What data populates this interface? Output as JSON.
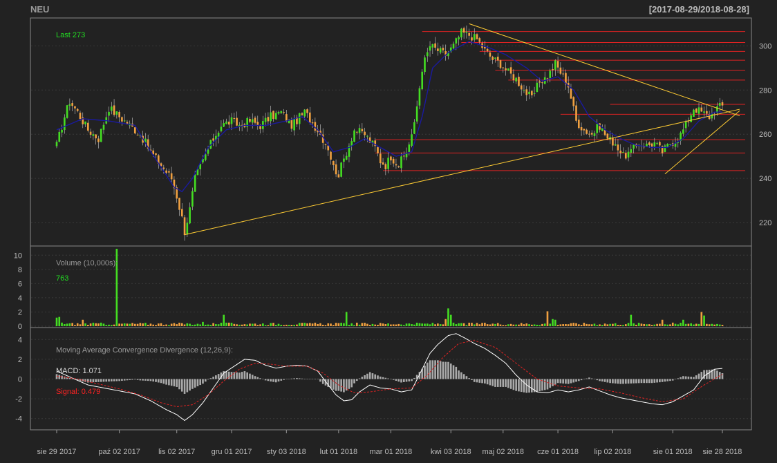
{
  "header": {
    "symbol": "NEU",
    "date_range": "[2017-08-29/2018-08-28]"
  },
  "colors": {
    "background": "#222222",
    "panel_border": "#888888",
    "grid": "#3a3a3a",
    "candle_up": "#44dd22",
    "candle_down": "#f0a040",
    "ma_line": "#1a1aa0",
    "support_resistance": "#dd2222",
    "trendline": "#ffcc33",
    "macd_line": "#ffffff",
    "signal_line": "#dd2222",
    "histogram": "#aaaaaa",
    "label_green": "#22dd22",
    "label_red": "#ff2222",
    "label_grey": "#999999"
  },
  "x_axis": {
    "labels": [
      {
        "label": "sie 29 2017",
        "index": 0
      },
      {
        "label": "paź 02 2017",
        "index": 24
      },
      {
        "label": "lis 02 2017",
        "index": 46
      },
      {
        "label": "gru 01 2017",
        "index": 67
      },
      {
        "label": "sty 03 2018",
        "index": 88
      },
      {
        "label": "lut 01 2018",
        "index": 108
      },
      {
        "label": "mar 01 2018",
        "index": 128
      },
      {
        "label": "kwi 03 2018",
        "index": 151
      },
      {
        "label": "maj 02 2018",
        "index": 171
      },
      {
        "label": "cze 01 2018",
        "index": 192
      },
      {
        "label": "lip 02 2018",
        "index": 213
      },
      {
        "label": "sie 01 2018",
        "index": 236
      },
      {
        "label": "sie 28 2018",
        "index": 255
      }
    ]
  },
  "price_panel": {
    "last_label": "Last 273"
  },
  "volume_panel": {
    "title": "Volume (10,000s):",
    "last_value": "763"
  },
  "macd_panel": {
    "title": "Moving Average Convergence Divergence (12,26,9):",
    "macd_label": "MACD: 1.071",
    "signal_label": "Signal: 0.479"
  },
  "chart_data": [
    {
      "type": "candlestick",
      "title": "NEU",
      "ylim": [
        210,
        312
      ],
      "yticks": [
        220,
        240,
        260,
        280,
        300
      ],
      "n_bars": 256,
      "anchors": [
        [
          0,
          255
        ],
        [
          3,
          268
        ],
        [
          5,
          275
        ],
        [
          8,
          270
        ],
        [
          12,
          262
        ],
        [
          16,
          258
        ],
        [
          20,
          272
        ],
        [
          24,
          268
        ],
        [
          28,
          264
        ],
        [
          32,
          260
        ],
        [
          36,
          252
        ],
        [
          40,
          246
        ],
        [
          44,
          240
        ],
        [
          46,
          232
        ],
        [
          48,
          222
        ],
        [
          49,
          216
        ],
        [
          51,
          226
        ],
        [
          53,
          240
        ],
        [
          56,
          248
        ],
        [
          60,
          258
        ],
        [
          63,
          264
        ],
        [
          67,
          266
        ],
        [
          70,
          264
        ],
        [
          74,
          266
        ],
        [
          78,
          264
        ],
        [
          82,
          268
        ],
        [
          86,
          270
        ],
        [
          90,
          264
        ],
        [
          95,
          270
        ],
        [
          100,
          262
        ],
        [
          104,
          254
        ],
        [
          106,
          245
        ],
        [
          108,
          242
        ],
        [
          111,
          252
        ],
        [
          114,
          262
        ],
        [
          118,
          260
        ],
        [
          122,
          254
        ],
        [
          124,
          248
        ],
        [
          126,
          246
        ],
        [
          128,
          250
        ],
        [
          131,
          246
        ],
        [
          134,
          252
        ],
        [
          137,
          264
        ],
        [
          140,
          290
        ],
        [
          143,
          300
        ],
        [
          146,
          298
        ],
        [
          149,
          296
        ],
        [
          152,
          300
        ],
        [
          155,
          306
        ],
        [
          158,
          305
        ],
        [
          161,
          303
        ],
        [
          164,
          298
        ],
        [
          167,
          294
        ],
        [
          170,
          292
        ],
        [
          173,
          288
        ],
        [
          176,
          285
        ],
        [
          179,
          280
        ],
        [
          182,
          276
        ],
        [
          185,
          284
        ],
        [
          188,
          286
        ],
        [
          191,
          292
        ],
        [
          194,
          286
        ],
        [
          196,
          282
        ],
        [
          199,
          266
        ],
        [
          202,
          262
        ],
        [
          205,
          260
        ],
        [
          208,
          264
        ],
        [
          211,
          258
        ],
        [
          214,
          256
        ],
        [
          217,
          250
        ],
        [
          220,
          252
        ],
        [
          223,
          256
        ],
        [
          226,
          255
        ],
        [
          229,
          256
        ],
        [
          232,
          252
        ],
        [
          235,
          256
        ],
        [
          238,
          258
        ],
        [
          241,
          264
        ],
        [
          244,
          272
        ],
        [
          247,
          270
        ],
        [
          250,
          268
        ],
        [
          253,
          272
        ],
        [
          255,
          273
        ]
      ],
      "moving_average_anchors": [
        [
          0,
          262
        ],
        [
          10,
          267
        ],
        [
          20,
          266
        ],
        [
          30,
          264
        ],
        [
          35,
          254
        ],
        [
          40,
          245
        ],
        [
          45,
          236
        ],
        [
          48,
          234
        ],
        [
          52,
          240
        ],
        [
          58,
          254
        ],
        [
          65,
          262
        ],
        [
          72,
          264
        ],
        [
          80,
          264
        ],
        [
          88,
          266
        ],
        [
          94,
          268
        ],
        [
          100,
          262
        ],
        [
          106,
          252
        ],
        [
          112,
          254
        ],
        [
          118,
          258
        ],
        [
          124,
          254
        ],
        [
          130,
          250
        ],
        [
          136,
          252
        ],
        [
          140,
          268
        ],
        [
          144,
          290
        ],
        [
          150,
          297
        ],
        [
          158,
          302
        ],
        [
          166,
          299
        ],
        [
          172,
          296
        ],
        [
          180,
          290
        ],
        [
          186,
          284
        ],
        [
          192,
          286
        ],
        [
          198,
          280
        ],
        [
          204,
          268
        ],
        [
          210,
          262
        ],
        [
          216,
          258
        ],
        [
          222,
          255
        ],
        [
          228,
          254
        ],
        [
          234,
          254
        ],
        [
          240,
          258
        ],
        [
          246,
          266
        ],
        [
          252,
          270
        ],
        [
          255,
          270
        ]
      ],
      "support_resistance_levels": [
        {
          "price": 306.5,
          "from": 140
        },
        {
          "price": 301.5,
          "from": 155
        },
        {
          "price": 297.5,
          "from": 162
        },
        {
          "price": 293.5,
          "from": 168
        },
        {
          "price": 289,
          "from": 168
        },
        {
          "price": 284.5,
          "from": 173
        },
        {
          "price": 273.5,
          "from": 212
        },
        {
          "price": 269,
          "from": 193
        },
        {
          "price": 257.5,
          "from": 122
        },
        {
          "price": 251.5,
          "from": 122
        },
        {
          "price": 243.5,
          "from": 125
        }
      ],
      "trendlines": [
        {
          "from": [
            49,
            214.5
          ],
          "to": [
            253,
            269
          ]
        },
        {
          "from": [
            158,
            310
          ],
          "to": [
            255,
            271
          ]
        },
        {
          "from": [
            233,
            242
          ],
          "to": [
            255,
            264
          ]
        }
      ]
    },
    {
      "type": "bar",
      "title": "Volume (10,000s):",
      "ylim": [
        0,
        11
      ],
      "yticks": [
        0,
        2,
        4,
        6,
        8,
        10
      ],
      "spikes": [
        {
          "index": 0,
          "value": 1.2
        },
        {
          "index": 1,
          "value": 1.3
        },
        {
          "index": 2,
          "value": 0.5
        },
        {
          "index": 10,
          "value": 0.9
        },
        {
          "index": 23,
          "value": 10.9
        },
        {
          "index": 56,
          "value": 0.6
        },
        {
          "index": 64,
          "value": 1.6
        },
        {
          "index": 111,
          "value": 2.0
        },
        {
          "index": 149,
          "value": 1.0
        },
        {
          "index": 150,
          "value": 2.5
        },
        {
          "index": 151,
          "value": 1.6
        },
        {
          "index": 188,
          "value": 2.1
        },
        {
          "index": 190,
          "value": 1.0
        },
        {
          "index": 191,
          "value": 0.9
        },
        {
          "index": 220,
          "value": 1.6
        },
        {
          "index": 232,
          "value": 0.9
        },
        {
          "index": 236,
          "value": 0.5
        },
        {
          "index": 240,
          "value": 0.9
        },
        {
          "index": 247,
          "value": 2.0
        },
        {
          "index": 248,
          "value": 1.5
        }
      ]
    },
    {
      "type": "line",
      "title": "Moving Average Convergence Divergence (12,26,9):",
      "ylim": [
        -5,
        5
      ],
      "yticks": [
        -4,
        -2,
        0,
        2,
        4
      ],
      "macd_anchors": [
        [
          0,
          0.8
        ],
        [
          6,
          0.1
        ],
        [
          12,
          -0.6
        ],
        [
          18,
          -0.9
        ],
        [
          24,
          -1.2
        ],
        [
          30,
          -1.5
        ],
        [
          36,
          -2.2
        ],
        [
          42,
          -3.1
        ],
        [
          46,
          -3.6
        ],
        [
          49,
          -4.2
        ],
        [
          52,
          -3.6
        ],
        [
          56,
          -2.4
        ],
        [
          60,
          -0.9
        ],
        [
          64,
          0.6
        ],
        [
          68,
          1.3
        ],
        [
          72,
          2.0
        ],
        [
          76,
          1.9
        ],
        [
          80,
          1.4
        ],
        [
          84,
          1.1
        ],
        [
          88,
          1.3
        ],
        [
          92,
          1.4
        ],
        [
          96,
          1.3
        ],
        [
          100,
          0.8
        ],
        [
          104,
          -0.6
        ],
        [
          107,
          -1.6
        ],
        [
          110,
          -2.2
        ],
        [
          113,
          -2.1
        ],
        [
          116,
          -1.3
        ],
        [
          120,
          -0.6
        ],
        [
          124,
          -0.9
        ],
        [
          128,
          -1.0
        ],
        [
          132,
          -1.3
        ],
        [
          136,
          -1.1
        ],
        [
          140,
          1.0
        ],
        [
          143,
          2.6
        ],
        [
          146,
          3.5
        ],
        [
          150,
          4.4
        ],
        [
          153,
          4.6
        ],
        [
          156,
          4.2
        ],
        [
          160,
          3.6
        ],
        [
          164,
          3.1
        ],
        [
          168,
          2.4
        ],
        [
          172,
          1.6
        ],
        [
          176,
          0.4
        ],
        [
          180,
          -0.6
        ],
        [
          184,
          -1.3
        ],
        [
          188,
          -1.4
        ],
        [
          192,
          -1.1
        ],
        [
          196,
          -1.3
        ],
        [
          200,
          -1.1
        ],
        [
          204,
          -0.8
        ],
        [
          208,
          -1.2
        ],
        [
          212,
          -1.6
        ],
        [
          216,
          -1.9
        ],
        [
          220,
          -2.1
        ],
        [
          224,
          -2.3
        ],
        [
          228,
          -2.5
        ],
        [
          232,
          -2.6
        ],
        [
          236,
          -2.3
        ],
        [
          240,
          -1.7
        ],
        [
          244,
          -1.1
        ],
        [
          248,
          0.3
        ],
        [
          252,
          1.0
        ],
        [
          255,
          1.071
        ]
      ],
      "signal_anchors": [
        [
          0,
          0.3
        ],
        [
          8,
          0.0
        ],
        [
          16,
          -0.5
        ],
        [
          24,
          -1.0
        ],
        [
          32,
          -1.6
        ],
        [
          40,
          -2.4
        ],
        [
          46,
          -2.8
        ],
        [
          52,
          -2.6
        ],
        [
          58,
          -1.6
        ],
        [
          64,
          -0.2
        ],
        [
          70,
          1.0
        ],
        [
          76,
          1.6
        ],
        [
          82,
          1.5
        ],
        [
          88,
          1.3
        ],
        [
          96,
          1.3
        ],
        [
          102,
          0.6
        ],
        [
          108,
          -0.6
        ],
        [
          114,
          -1.4
        ],
        [
          120,
          -1.3
        ],
        [
          128,
          -1.0
        ],
        [
          136,
          -0.9
        ],
        [
          142,
          0.4
        ],
        [
          148,
          2.2
        ],
        [
          154,
          3.6
        ],
        [
          160,
          3.9
        ],
        [
          168,
          3.2
        ],
        [
          176,
          1.6
        ],
        [
          184,
          0.0
        ],
        [
          192,
          -0.7
        ],
        [
          200,
          -0.9
        ],
        [
          208,
          -1.0
        ],
        [
          216,
          -1.4
        ],
        [
          224,
          -1.9
        ],
        [
          232,
          -2.3
        ],
        [
          240,
          -2.0
        ],
        [
          248,
          -0.6
        ],
        [
          255,
          0.479
        ]
      ]
    }
  ]
}
